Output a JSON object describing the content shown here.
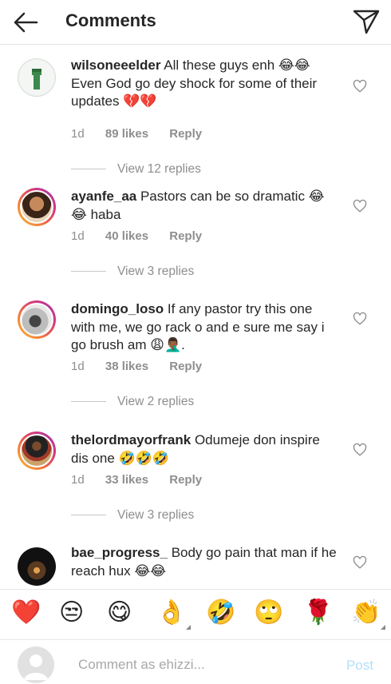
{
  "header": {
    "title": "Comments"
  },
  "comments": [
    {
      "username": "wilsoneeelder",
      "text": "All these guys enh 😂😂 Even God go dey shock for some of their updates 💔💔",
      "age": "1d",
      "likes": "89 likes",
      "reply": "Reply",
      "view_replies": "View 12 replies"
    },
    {
      "username": "ayanfe_aa",
      "text": "Pastors can be so dramatic 😂😂 haba",
      "age": "1d",
      "likes": "40 likes",
      "reply": "Reply",
      "view_replies": "View 3 replies"
    },
    {
      "username": "domingo_loso",
      "text": "If any pastor try this one with me, we go rack o and e sure me say i go brush am 😩🤦🏾‍♂️.",
      "age": "1d",
      "likes": "38 likes",
      "reply": "Reply",
      "view_replies": "View 2 replies"
    },
    {
      "username": "thelordmayorfrank",
      "text": "Odumeje don inspire dis one 🤣🤣🤣",
      "age": "1d",
      "likes": "33 likes",
      "reply": "Reply",
      "view_replies": "View 3 replies"
    },
    {
      "username": "bae_progress_",
      "text": "Body go pain that man if he reach hux 😂😂"
    }
  ],
  "emoji_bar": [
    "❤️",
    "😒",
    "😋",
    "👌",
    "🤣",
    "🙄",
    "🌹",
    "👏"
  ],
  "composer": {
    "placeholder": "Comment as ehizzi...",
    "post_label": "Post"
  },
  "colors": {
    "link_blue_disabled": "#b2dffc",
    "muted": "#8e8e8e"
  }
}
